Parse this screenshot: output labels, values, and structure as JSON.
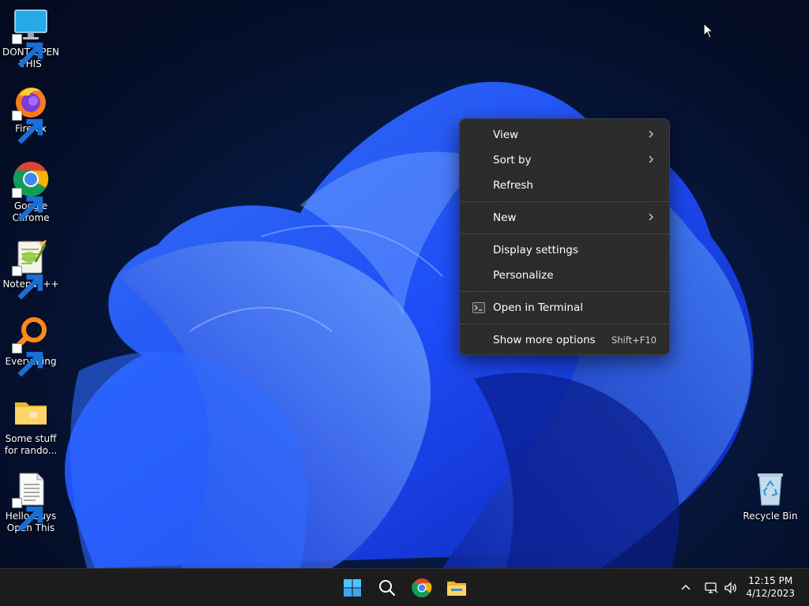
{
  "desktop": {
    "icons": [
      {
        "label": "DONT OPEN THIS",
        "icon": "monitor-icon"
      },
      {
        "label": "Firefox",
        "icon": "firefox-icon"
      },
      {
        "label": "Google Chrome",
        "icon": "chrome-icon"
      },
      {
        "label": "Notepad++",
        "icon": "notepadpp-icon"
      },
      {
        "label": "Everything",
        "icon": "search-magnifier-icon"
      },
      {
        "label": "Some stuff for rando...",
        "icon": "folder-icon"
      },
      {
        "label": "Hello Guys Open This",
        "icon": "text-document-icon"
      },
      {
        "label": "Recycle Bin",
        "icon": "recycle-bin-icon"
      }
    ]
  },
  "context_menu": {
    "items": [
      {
        "label": "View",
        "submenu": true
      },
      {
        "label": "Sort by",
        "submenu": true
      },
      {
        "label": "Refresh"
      },
      {
        "label": "New",
        "submenu": true
      },
      {
        "label": "Display settings"
      },
      {
        "label": "Personalize"
      },
      {
        "label": "Open in Terminal",
        "icon": "terminal-icon"
      },
      {
        "label": "Show more options",
        "shortcut": "Shift+F10"
      }
    ]
  },
  "taskbar": {
    "apps": [
      "start-icon",
      "search-icon",
      "chrome-icon",
      "file-explorer-icon"
    ],
    "tray": [
      "chevron-up-icon",
      "network-icon",
      "volume-icon"
    ],
    "time": "12:15 PM",
    "date": "4/12/2023"
  },
  "colors": {
    "menu_bg": "#2c2c2c",
    "taskbar_bg": "#1c1c1c",
    "wallpaper_accent": "#1f4fff"
  }
}
